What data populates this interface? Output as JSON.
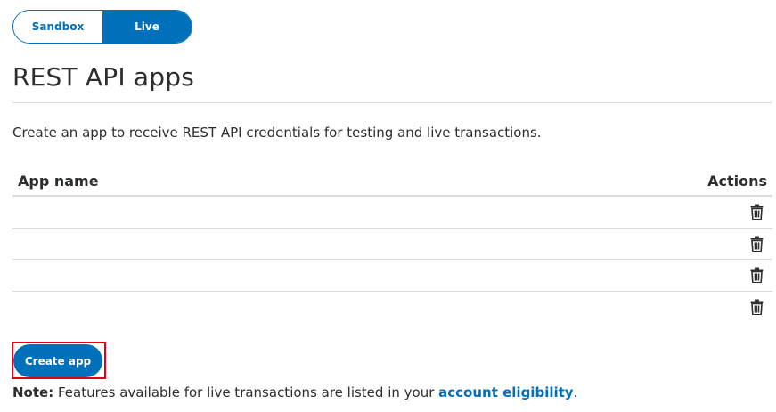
{
  "environment_toggle": {
    "sandbox_label": "Sandbox",
    "live_label": "Live",
    "selected": "Live"
  },
  "page": {
    "title": "REST API apps",
    "description": "Create an app to receive REST API credentials for testing and live transactions."
  },
  "table": {
    "columns": {
      "app_name": "App name",
      "actions": "Actions"
    },
    "rows": [
      {
        "name": "",
        "action_icon": "trash-icon"
      },
      {
        "name": "",
        "action_icon": "trash-icon"
      },
      {
        "name": "",
        "action_icon": "trash-icon"
      },
      {
        "name": "",
        "action_icon": "trash-icon"
      }
    ]
  },
  "create_button": {
    "label": "Create app"
  },
  "note": {
    "label": "Note:",
    "text": " Features available for live transactions are listed in your ",
    "link_text": "account eligibility",
    "trailing": "."
  },
  "colors": {
    "brand_blue": "#0070ba",
    "highlight_red": "#e0001b",
    "text": "#2c2e2f",
    "divider": "#dcdcdc"
  }
}
